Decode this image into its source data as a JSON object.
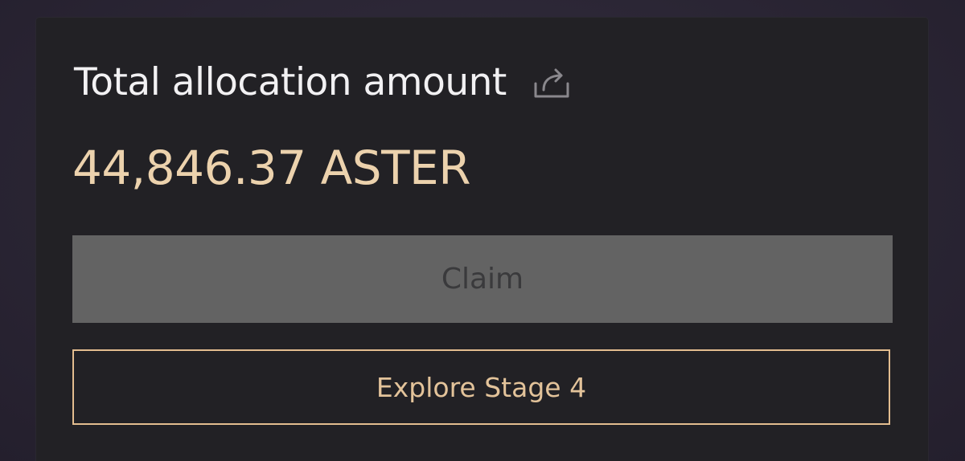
{
  "card": {
    "title": "Total allocation amount",
    "share_icon": "share-icon",
    "amount": "44,846.37 ASTER",
    "claim_label": "Claim",
    "explore_label": "Explore Stage 4"
  },
  "colors": {
    "card_background": "#222125",
    "title_text": "#f2f1f3",
    "amount_text": "#ecd2ad",
    "claim_background": "#636363",
    "claim_text": "#3a3a3c",
    "accent_border": "#e3bd8f"
  }
}
